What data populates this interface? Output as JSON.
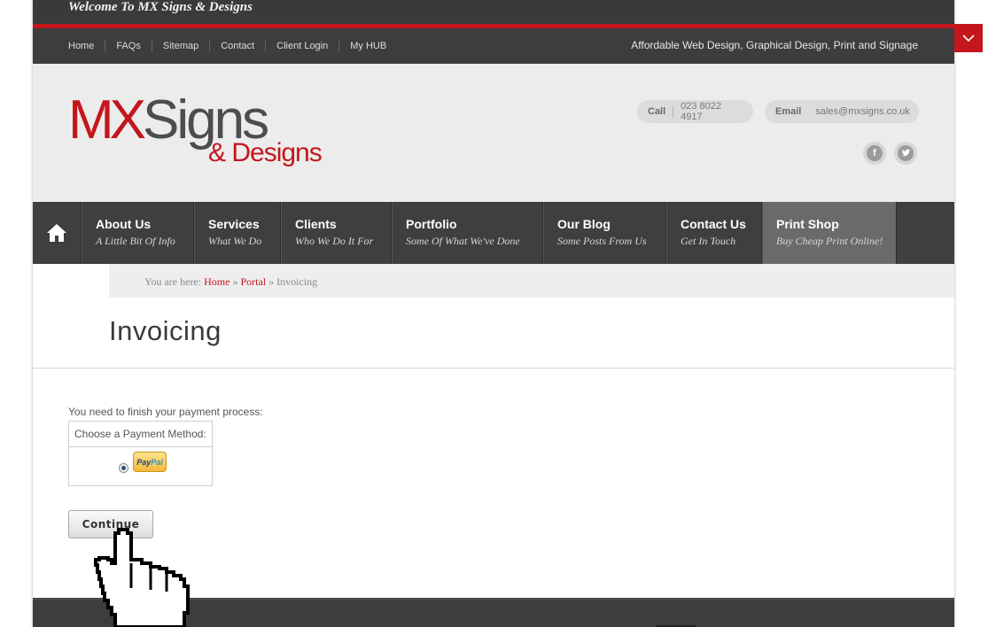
{
  "topbar": {
    "welcome": "Welcome To MX Signs & Designs"
  },
  "topnav": {
    "links": [
      "Home",
      "FAQs",
      "Sitemap",
      "Contact",
      "Client Login",
      "My HUB"
    ],
    "tagline": "Affordable Web Design, Graphical Design, Print and Signage"
  },
  "header": {
    "logo": {
      "mx": "MX",
      "signs": "Signs",
      "designs": "& Designs"
    },
    "call_label": "Call",
    "call_value": "023 8022 4917",
    "email_label": "Email",
    "email_value": "sales@mxsigns.co.uk",
    "social": [
      "facebook-icon",
      "twitter-icon"
    ]
  },
  "mainnav": {
    "home_icon": "home-icon",
    "items": [
      {
        "title": "About Us",
        "sub": "A Little Bit Of Info"
      },
      {
        "title": "Services",
        "sub": "What We Do"
      },
      {
        "title": "Clients",
        "sub": "Who We Do It For"
      },
      {
        "title": "Portfolio",
        "sub": "Some Of What We've Done"
      },
      {
        "title": "Our Blog",
        "sub": "Some Posts From Us"
      },
      {
        "title": "Contact Us",
        "sub": "Get In Touch"
      },
      {
        "title": "Print Shop",
        "sub": "Buy Cheap Print Online!"
      }
    ],
    "active_index": 6
  },
  "breadcrumb": {
    "prefix": "You are here:",
    "home": "Home",
    "sep": "»",
    "portal": "Portal",
    "current": "Invoicing"
  },
  "page": {
    "title": "Invoicing"
  },
  "payment": {
    "message": "You need to finish your payment process:",
    "choose_label": "Choose a Payment Method:",
    "method": {
      "pp1": "Pay",
      "pp2": "Pal"
    },
    "selected": "PayPal",
    "continue_label": "Continue"
  },
  "colors": {
    "brand_red": "#c4161c",
    "dark_bar": "#3d3d3d",
    "header_bg": "#ececec"
  }
}
